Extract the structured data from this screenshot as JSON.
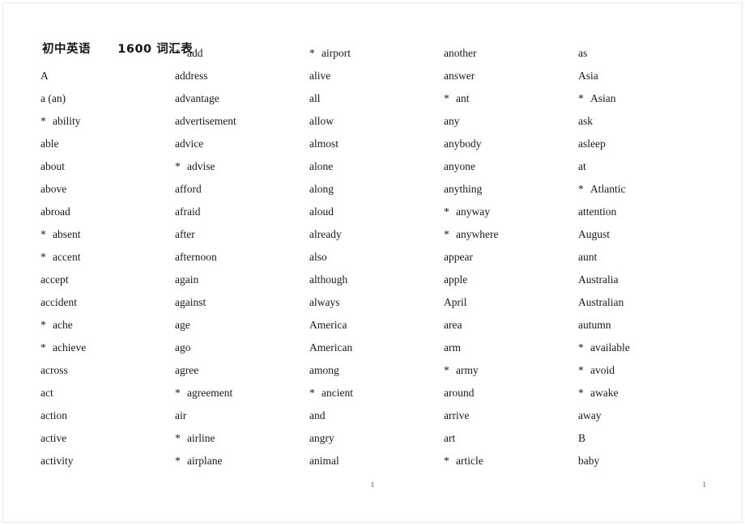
{
  "document": {
    "heading": "初中英语      1600 词汇表",
    "page_number_center": "1",
    "page_number_right": "1"
  },
  "columns": [
    {
      "name": "column-1",
      "words": [
        {
          "star": false,
          "text": "A"
        },
        {
          "star": false,
          "text": "a (an)"
        },
        {
          "star": true,
          "text": "ability"
        },
        {
          "star": false,
          "text": "able"
        },
        {
          "star": false,
          "text": "about"
        },
        {
          "star": false,
          "text": "above"
        },
        {
          "star": false,
          "text": "abroad"
        },
        {
          "star": true,
          "text": "absent"
        },
        {
          "star": true,
          "text": "accent"
        },
        {
          "star": false,
          "text": "accept"
        },
        {
          "star": false,
          "text": "accident"
        },
        {
          "star": true,
          "text": "ache"
        },
        {
          "star": true,
          "text": "achieve"
        },
        {
          "star": false,
          "text": "across"
        },
        {
          "star": false,
          "text": "act"
        },
        {
          "star": false,
          "text": "action"
        },
        {
          "star": false,
          "text": "active"
        },
        {
          "star": false,
          "text": "activity"
        }
      ]
    },
    {
      "name": "column-2",
      "words": [
        {
          "star": true,
          "text": "add"
        },
        {
          "star": false,
          "text": "address"
        },
        {
          "star": false,
          "text": "advantage"
        },
        {
          "star": false,
          "text": "advertisement"
        },
        {
          "star": false,
          "text": "advice"
        },
        {
          "star": true,
          "text": "advise"
        },
        {
          "star": false,
          "text": "afford"
        },
        {
          "star": false,
          "text": "afraid"
        },
        {
          "star": false,
          "text": "after"
        },
        {
          "star": false,
          "text": "afternoon"
        },
        {
          "star": false,
          "text": "again"
        },
        {
          "star": false,
          "text": "against"
        },
        {
          "star": false,
          "text": "age"
        },
        {
          "star": false,
          "text": "ago"
        },
        {
          "star": false,
          "text": "agree"
        },
        {
          "star": true,
          "text": "agreement"
        },
        {
          "star": false,
          "text": "air"
        },
        {
          "star": true,
          "text": "airline"
        },
        {
          "star": true,
          "text": "airplane"
        }
      ]
    },
    {
      "name": "column-3",
      "words": [
        {
          "star": true,
          "text": "airport"
        },
        {
          "star": false,
          "text": "alive"
        },
        {
          "star": false,
          "text": "all"
        },
        {
          "star": false,
          "text": "allow"
        },
        {
          "star": false,
          "text": "almost"
        },
        {
          "star": false,
          "text": "alone"
        },
        {
          "star": false,
          "text": "along"
        },
        {
          "star": false,
          "text": "aloud"
        },
        {
          "star": false,
          "text": "already"
        },
        {
          "star": false,
          "text": "also"
        },
        {
          "star": false,
          "text": "although"
        },
        {
          "star": false,
          "text": "always"
        },
        {
          "star": false,
          "text": "America"
        },
        {
          "star": false,
          "text": "American"
        },
        {
          "star": false,
          "text": "among"
        },
        {
          "star": true,
          "text": "ancient"
        },
        {
          "star": false,
          "text": "and"
        },
        {
          "star": false,
          "text": "angry"
        },
        {
          "star": false,
          "text": "animal"
        }
      ]
    },
    {
      "name": "column-4",
      "words": [
        {
          "star": false,
          "text": "another"
        },
        {
          "star": false,
          "text": "answer"
        },
        {
          "star": true,
          "text": "ant"
        },
        {
          "star": false,
          "text": "any"
        },
        {
          "star": false,
          "text": "anybody"
        },
        {
          "star": false,
          "text": "anyone"
        },
        {
          "star": false,
          "text": "anything"
        },
        {
          "star": true,
          "text": "anyway"
        },
        {
          "star": true,
          "text": "anywhere"
        },
        {
          "star": false,
          "text": "appear"
        },
        {
          "star": false,
          "text": "apple"
        },
        {
          "star": false,
          "text": "April"
        },
        {
          "star": false,
          "text": "area"
        },
        {
          "star": false,
          "text": "arm"
        },
        {
          "star": true,
          "text": "army"
        },
        {
          "star": false,
          "text": "around"
        },
        {
          "star": false,
          "text": "arrive"
        },
        {
          "star": false,
          "text": "art"
        },
        {
          "star": true,
          "text": "article"
        }
      ]
    },
    {
      "name": "column-5",
      "words": [
        {
          "star": false,
          "text": "as"
        },
        {
          "star": false,
          "text": "Asia"
        },
        {
          "star": true,
          "text": "Asian"
        },
        {
          "star": false,
          "text": "ask"
        },
        {
          "star": false,
          "text": "asleep"
        },
        {
          "star": false,
          "text": "at"
        },
        {
          "star": true,
          "text": "Atlantic"
        },
        {
          "star": false,
          "text": "attention"
        },
        {
          "star": false,
          "text": "August"
        },
        {
          "star": false,
          "text": "aunt"
        },
        {
          "star": false,
          "text": "Australia"
        },
        {
          "star": false,
          "text": "Australian"
        },
        {
          "star": false,
          "text": "autumn"
        },
        {
          "star": true,
          "text": "available"
        },
        {
          "star": true,
          "text": "avoid"
        },
        {
          "star": true,
          "text": "awake"
        },
        {
          "star": false,
          "text": "away"
        },
        {
          "star": false,
          "text": "B"
        },
        {
          "star": false,
          "text": "baby"
        }
      ]
    }
  ]
}
